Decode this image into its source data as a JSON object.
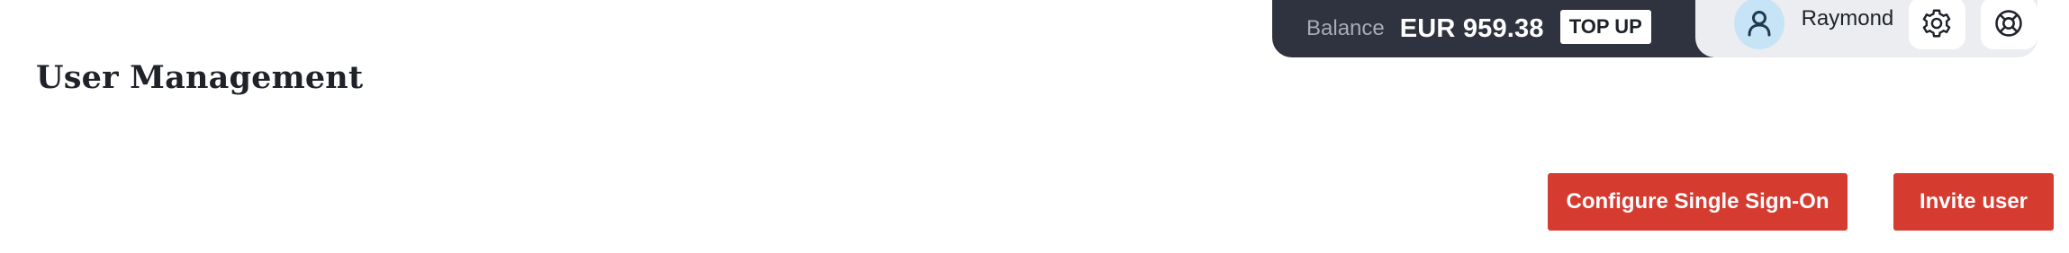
{
  "header": {
    "balance_label": "Balance",
    "balance_amount": "EUR 959.38",
    "topup_label": "TOP UP",
    "user_name": "Raymond",
    "icons": {
      "avatar": "user-icon",
      "settings": "gear-icon",
      "help": "lifebuoy-icon"
    }
  },
  "main": {
    "title": "User Management",
    "configure_sso_label": "Configure Single Sign-On",
    "invite_user_label": "Invite user"
  },
  "colors": {
    "balance_panel": "#2f3340",
    "user_panel": "#ebedf0",
    "avatar_bg": "#c7e4f6",
    "primary_button": "#d63b30"
  }
}
